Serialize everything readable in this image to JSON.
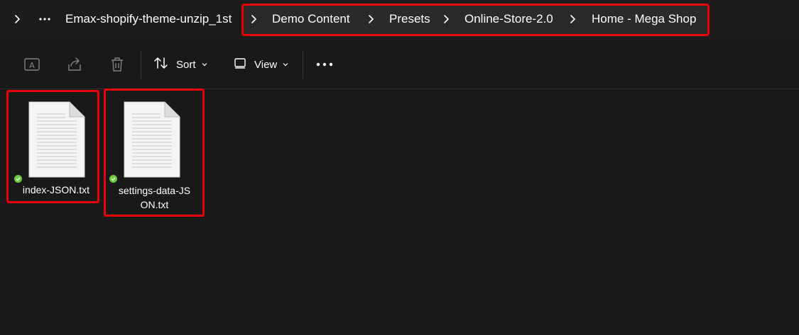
{
  "breadcrumb": {
    "root": "Emax-shopify-theme-unzip_1st",
    "items": [
      "Demo Content",
      "Presets",
      "Online-Store-2.0",
      "Home - Mega Shop"
    ]
  },
  "toolbar": {
    "sort_label": "Sort",
    "view_label": "View"
  },
  "files": [
    {
      "name_line1": "index-JSON.txt",
      "name_line2": "",
      "status": "synced"
    },
    {
      "name_line1": "settings-data-JS",
      "name_line2": "ON.txt",
      "status": "synced"
    }
  ],
  "colors": {
    "highlight": "#e8000b",
    "status": "#6ccb3e",
    "background": "#191919"
  }
}
